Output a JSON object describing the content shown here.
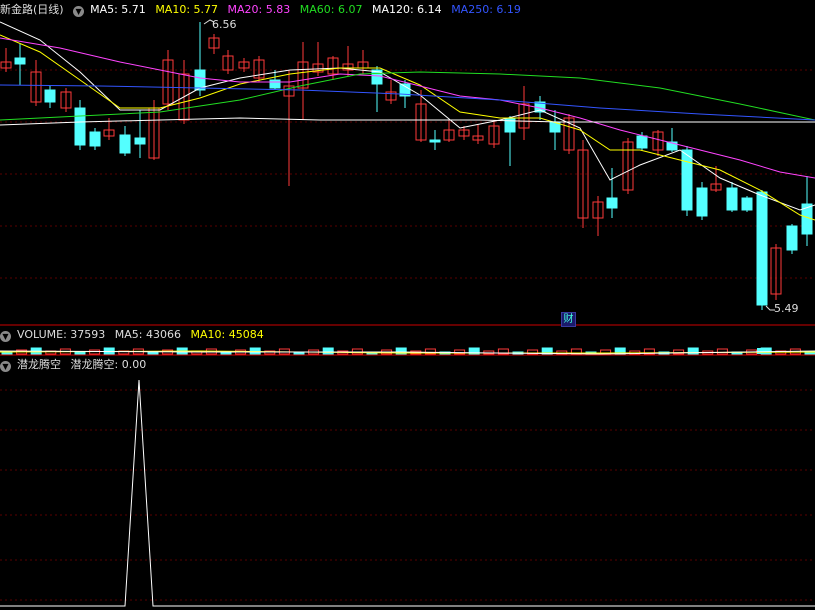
{
  "main_header": {
    "stock_name": "新金路",
    "period": "(日线)",
    "ma5": "MA5: 5.71",
    "ma10": "MA10: 5.77",
    "ma20": "MA20: 5.83",
    "ma60": "MA60: 6.07",
    "ma120": "MA120: 6.14",
    "ma250": "MA250: 6.19"
  },
  "price_labels": {
    "high": "6.56",
    "low": "5.49"
  },
  "finance_marker": "财",
  "volume_header": {
    "volume": "VOLUME: 37593",
    "ma5": "MA5: 43066",
    "ma10": "MA10: 45084"
  },
  "indicator_header": {
    "name": "潜龙腾空",
    "value": "潜龙腾空: 0.00"
  },
  "colors": {
    "up": "#ff3a3a",
    "down": "#54ffff",
    "ma5": "#ffffff",
    "ma10": "#ffff00",
    "ma20": "#ff44ff",
    "ma60": "#22dd22",
    "ma120": "#ffffff",
    "ma250": "#3355ff",
    "grid": "#5a0000",
    "separator": "#cc0000"
  },
  "icons": [
    "dropdown-circle-icon"
  ]
}
